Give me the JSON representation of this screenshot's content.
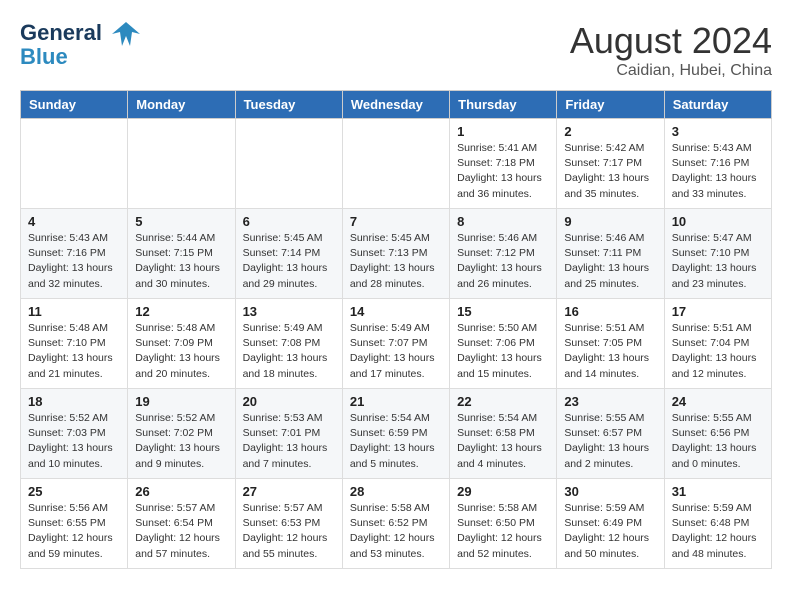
{
  "header": {
    "logo_line1": "General",
    "logo_line2": "Blue",
    "month_year": "August 2024",
    "location": "Caidian, Hubei, China"
  },
  "weekdays": [
    "Sunday",
    "Monday",
    "Tuesday",
    "Wednesday",
    "Thursday",
    "Friday",
    "Saturday"
  ],
  "weeks": [
    [
      {
        "day": "",
        "info": ""
      },
      {
        "day": "",
        "info": ""
      },
      {
        "day": "",
        "info": ""
      },
      {
        "day": "",
        "info": ""
      },
      {
        "day": "1",
        "info": "Sunrise: 5:41 AM\nSunset: 7:18 PM\nDaylight: 13 hours\nand 36 minutes."
      },
      {
        "day": "2",
        "info": "Sunrise: 5:42 AM\nSunset: 7:17 PM\nDaylight: 13 hours\nand 35 minutes."
      },
      {
        "day": "3",
        "info": "Sunrise: 5:43 AM\nSunset: 7:16 PM\nDaylight: 13 hours\nand 33 minutes."
      }
    ],
    [
      {
        "day": "4",
        "info": "Sunrise: 5:43 AM\nSunset: 7:16 PM\nDaylight: 13 hours\nand 32 minutes."
      },
      {
        "day": "5",
        "info": "Sunrise: 5:44 AM\nSunset: 7:15 PM\nDaylight: 13 hours\nand 30 minutes."
      },
      {
        "day": "6",
        "info": "Sunrise: 5:45 AM\nSunset: 7:14 PM\nDaylight: 13 hours\nand 29 minutes."
      },
      {
        "day": "7",
        "info": "Sunrise: 5:45 AM\nSunset: 7:13 PM\nDaylight: 13 hours\nand 28 minutes."
      },
      {
        "day": "8",
        "info": "Sunrise: 5:46 AM\nSunset: 7:12 PM\nDaylight: 13 hours\nand 26 minutes."
      },
      {
        "day": "9",
        "info": "Sunrise: 5:46 AM\nSunset: 7:11 PM\nDaylight: 13 hours\nand 25 minutes."
      },
      {
        "day": "10",
        "info": "Sunrise: 5:47 AM\nSunset: 7:10 PM\nDaylight: 13 hours\nand 23 minutes."
      }
    ],
    [
      {
        "day": "11",
        "info": "Sunrise: 5:48 AM\nSunset: 7:10 PM\nDaylight: 13 hours\nand 21 minutes."
      },
      {
        "day": "12",
        "info": "Sunrise: 5:48 AM\nSunset: 7:09 PM\nDaylight: 13 hours\nand 20 minutes."
      },
      {
        "day": "13",
        "info": "Sunrise: 5:49 AM\nSunset: 7:08 PM\nDaylight: 13 hours\nand 18 minutes."
      },
      {
        "day": "14",
        "info": "Sunrise: 5:49 AM\nSunset: 7:07 PM\nDaylight: 13 hours\nand 17 minutes."
      },
      {
        "day": "15",
        "info": "Sunrise: 5:50 AM\nSunset: 7:06 PM\nDaylight: 13 hours\nand 15 minutes."
      },
      {
        "day": "16",
        "info": "Sunrise: 5:51 AM\nSunset: 7:05 PM\nDaylight: 13 hours\nand 14 minutes."
      },
      {
        "day": "17",
        "info": "Sunrise: 5:51 AM\nSunset: 7:04 PM\nDaylight: 13 hours\nand 12 minutes."
      }
    ],
    [
      {
        "day": "18",
        "info": "Sunrise: 5:52 AM\nSunset: 7:03 PM\nDaylight: 13 hours\nand 10 minutes."
      },
      {
        "day": "19",
        "info": "Sunrise: 5:52 AM\nSunset: 7:02 PM\nDaylight: 13 hours\nand 9 minutes."
      },
      {
        "day": "20",
        "info": "Sunrise: 5:53 AM\nSunset: 7:01 PM\nDaylight: 13 hours\nand 7 minutes."
      },
      {
        "day": "21",
        "info": "Sunrise: 5:54 AM\nSunset: 6:59 PM\nDaylight: 13 hours\nand 5 minutes."
      },
      {
        "day": "22",
        "info": "Sunrise: 5:54 AM\nSunset: 6:58 PM\nDaylight: 13 hours\nand 4 minutes."
      },
      {
        "day": "23",
        "info": "Sunrise: 5:55 AM\nSunset: 6:57 PM\nDaylight: 13 hours\nand 2 minutes."
      },
      {
        "day": "24",
        "info": "Sunrise: 5:55 AM\nSunset: 6:56 PM\nDaylight: 13 hours\nand 0 minutes."
      }
    ],
    [
      {
        "day": "25",
        "info": "Sunrise: 5:56 AM\nSunset: 6:55 PM\nDaylight: 12 hours\nand 59 minutes."
      },
      {
        "day": "26",
        "info": "Sunrise: 5:57 AM\nSunset: 6:54 PM\nDaylight: 12 hours\nand 57 minutes."
      },
      {
        "day": "27",
        "info": "Sunrise: 5:57 AM\nSunset: 6:53 PM\nDaylight: 12 hours\nand 55 minutes."
      },
      {
        "day": "28",
        "info": "Sunrise: 5:58 AM\nSunset: 6:52 PM\nDaylight: 12 hours\nand 53 minutes."
      },
      {
        "day": "29",
        "info": "Sunrise: 5:58 AM\nSunset: 6:50 PM\nDaylight: 12 hours\nand 52 minutes."
      },
      {
        "day": "30",
        "info": "Sunrise: 5:59 AM\nSunset: 6:49 PM\nDaylight: 12 hours\nand 50 minutes."
      },
      {
        "day": "31",
        "info": "Sunrise: 5:59 AM\nSunset: 6:48 PM\nDaylight: 12 hours\nand 48 minutes."
      }
    ]
  ]
}
